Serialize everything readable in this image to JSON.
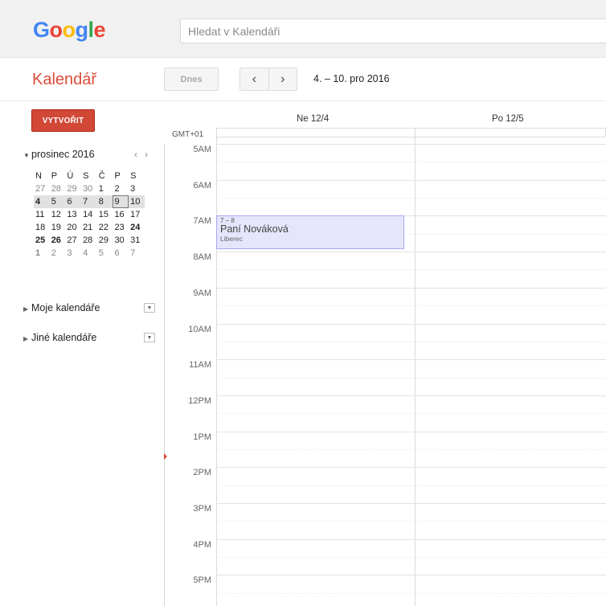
{
  "header": {
    "logo": [
      {
        "ch": "G",
        "color": "#4285f4"
      },
      {
        "ch": "o",
        "color": "#ea4335"
      },
      {
        "ch": "o",
        "color": "#fbbc05"
      },
      {
        "ch": "g",
        "color": "#4285f4"
      },
      {
        "ch": "l",
        "color": "#34a853"
      },
      {
        "ch": "e",
        "color": "#ea4335"
      }
    ],
    "search_placeholder": "Hledat v Kalendáři"
  },
  "toolbar": {
    "app_name": "Kalendář",
    "today_label": "Dnes",
    "prev_icon": "chevron-left-icon",
    "next_icon": "chevron-right-icon",
    "prev_glyph": "‹",
    "next_glyph": "›",
    "date_range": "4. – 10. pro 2016"
  },
  "sidebar": {
    "create_label": "VYTVOŘIT",
    "create_color": "#d14836",
    "mini_calendar": {
      "month_label": "prosinec 2016",
      "weekdays": [
        "N",
        "P",
        "Ú",
        "S",
        "Č",
        "P",
        "S"
      ],
      "weeks": [
        {
          "current": false,
          "days": [
            {
              "d": "27",
              "other": true
            },
            {
              "d": "28",
              "other": true
            },
            {
              "d": "29",
              "other": true
            },
            {
              "d": "30",
              "other": true
            },
            {
              "d": "1"
            },
            {
              "d": "2"
            },
            {
              "d": "3"
            }
          ]
        },
        {
          "current": true,
          "days": [
            {
              "d": "4",
              "bold": true
            },
            {
              "d": "5"
            },
            {
              "d": "6"
            },
            {
              "d": "7"
            },
            {
              "d": "8"
            },
            {
              "d": "9",
              "selected": true
            },
            {
              "d": "10"
            }
          ]
        },
        {
          "current": false,
          "days": [
            {
              "d": "11"
            },
            {
              "d": "12"
            },
            {
              "d": "13"
            },
            {
              "d": "14"
            },
            {
              "d": "15"
            },
            {
              "d": "16"
            },
            {
              "d": "17"
            }
          ]
        },
        {
          "current": false,
          "days": [
            {
              "d": "18"
            },
            {
              "d": "19"
            },
            {
              "d": "20"
            },
            {
              "d": "21"
            },
            {
              "d": "22"
            },
            {
              "d": "23"
            },
            {
              "d": "24",
              "bold": true
            }
          ]
        },
        {
          "current": false,
          "days": [
            {
              "d": "25",
              "bold": true
            },
            {
              "d": "26",
              "bold": true
            },
            {
              "d": "27"
            },
            {
              "d": "28"
            },
            {
              "d": "29"
            },
            {
              "d": "30"
            },
            {
              "d": "31"
            }
          ]
        },
        {
          "current": false,
          "days": [
            {
              "d": "1",
              "other": true,
              "bold": true
            },
            {
              "d": "2",
              "other": true
            },
            {
              "d": "3",
              "other": true
            },
            {
              "d": "4",
              "other": true
            },
            {
              "d": "5",
              "other": true
            },
            {
              "d": "6",
              "other": true
            },
            {
              "d": "7",
              "other": true
            }
          ]
        }
      ]
    },
    "my_calendars_label": "Moje kalendáře",
    "other_calendars_label": "Jiné kalendáře"
  },
  "calendar": {
    "timezone": "GMT+01",
    "days": [
      {
        "label": "Ne 12/4"
      },
      {
        "label": "Po 12/5"
      }
    ],
    "hours": [
      "5AM",
      "6AM",
      "7AM",
      "8AM",
      "9AM",
      "10AM",
      "11AM",
      "12PM",
      "1PM",
      "2PM",
      "3PM",
      "4PM",
      "5PM"
    ],
    "events": [
      {
        "time": "7 – 8",
        "title": "Paní Nováková",
        "location": "Liberec",
        "color": "#e5e5fb"
      }
    ]
  }
}
